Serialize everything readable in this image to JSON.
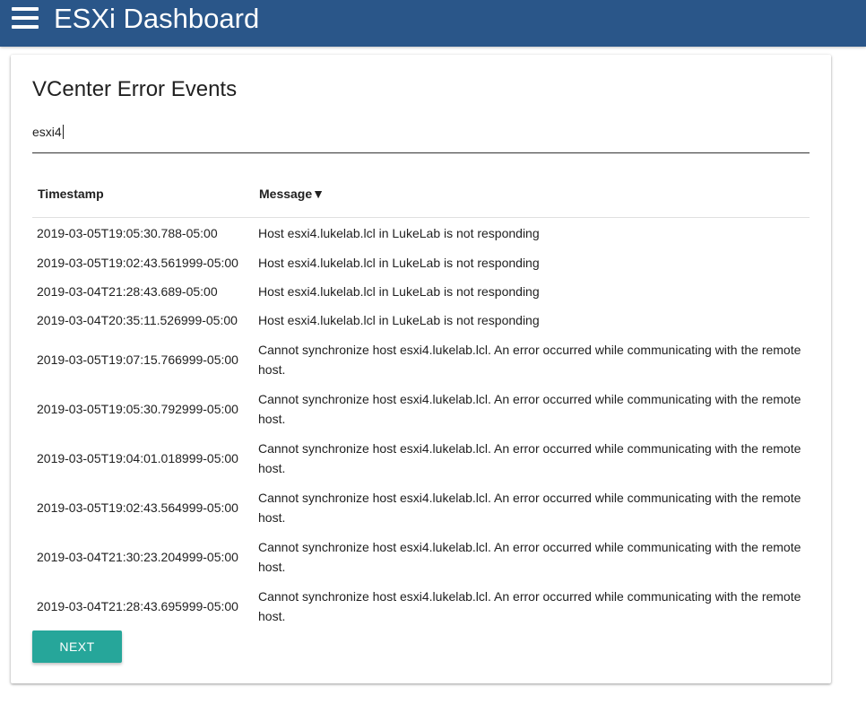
{
  "header": {
    "app_title": "ESXi Dashboard",
    "menu_icon": "hamburger-menu-icon",
    "background_color": "#2a5689"
  },
  "card": {
    "title": "VCenter Error Events",
    "search_value": "esxi4",
    "columns": {
      "timestamp": "Timestamp",
      "message": "Message",
      "sort_indicator": "▼"
    },
    "rows": [
      {
        "timestamp": "2019-03-05T19:05:30.788-05:00",
        "message": "Host esxi4.lukelab.lcl in LukeLab is not responding"
      },
      {
        "timestamp": "2019-03-05T19:02:43.561999-05:00",
        "message": "Host esxi4.lukelab.lcl in LukeLab is not responding"
      },
      {
        "timestamp": "2019-03-04T21:28:43.689-05:00",
        "message": "Host esxi4.lukelab.lcl in LukeLab is not responding"
      },
      {
        "timestamp": "2019-03-04T20:35:11.526999-05:00",
        "message": "Host esxi4.lukelab.lcl in LukeLab is not responding"
      },
      {
        "timestamp": "2019-03-05T19:07:15.766999-05:00",
        "message": "Cannot synchronize host esxi4.lukelab.lcl. An error occurred while communicating with the remote host."
      },
      {
        "timestamp": "2019-03-05T19:05:30.792999-05:00",
        "message": "Cannot synchronize host esxi4.lukelab.lcl. An error occurred while communicating with the remote host."
      },
      {
        "timestamp": "2019-03-05T19:04:01.018999-05:00",
        "message": "Cannot synchronize host esxi4.lukelab.lcl. An error occurred while communicating with the remote host."
      },
      {
        "timestamp": "2019-03-05T19:02:43.564999-05:00",
        "message": "Cannot synchronize host esxi4.lukelab.lcl. An error occurred while communicating with the remote host."
      },
      {
        "timestamp": "2019-03-04T21:30:23.204999-05:00",
        "message": "Cannot synchronize host esxi4.lukelab.lcl. An error occurred while communicating with the remote host."
      },
      {
        "timestamp": "2019-03-04T21:28:43.695999-05:00",
        "message": "Cannot synchronize host esxi4.lukelab.lcl. An error occurred while communicating with the remote host."
      }
    ],
    "next_label": "NEXT",
    "next_button_color": "#26a69a"
  }
}
